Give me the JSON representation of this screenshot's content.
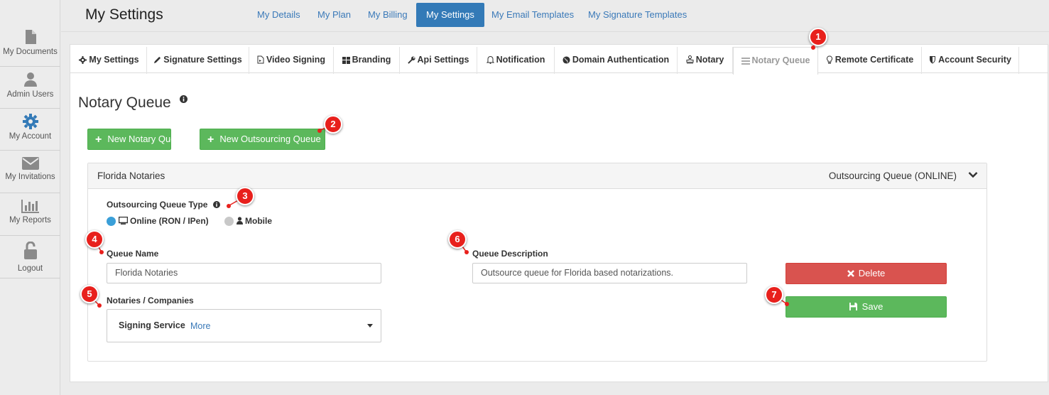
{
  "sidebar": {
    "items": [
      {
        "label": "My Documents",
        "icon": "document-icon"
      },
      {
        "label": "Admin Users",
        "icon": "user-icon"
      },
      {
        "label": "My Account",
        "icon": "gear-icon"
      },
      {
        "label": "My Invitations",
        "icon": "envelope-icon"
      },
      {
        "label": "My Reports",
        "icon": "bar-chart-icon"
      },
      {
        "label": "Logout",
        "icon": "unlock-icon"
      }
    ]
  },
  "header": {
    "title": "My Settings",
    "nav": [
      "My Details",
      "My Plan",
      "My Billing",
      "My Settings",
      "My Email Templates",
      "My Signature Templates"
    ],
    "active_nav": "My Settings"
  },
  "tabs": [
    {
      "label": "My Settings",
      "icon": "gear-icon"
    },
    {
      "label": "Signature Settings",
      "icon": "pencil-icon"
    },
    {
      "label": "Video Signing",
      "icon": "video-file-icon"
    },
    {
      "label": "Branding",
      "icon": "grid-icon"
    },
    {
      "label": "Api Settings",
      "icon": "wrench-icon"
    },
    {
      "label": "Notification",
      "icon": "bell-icon"
    },
    {
      "label": "Domain Authentication",
      "icon": "globe-icon"
    },
    {
      "label": "Notary",
      "icon": "stamp-icon"
    },
    {
      "label": "Notary Queue",
      "icon": "list-icon"
    },
    {
      "label": "Remote Certificate",
      "icon": "lightbulb-icon"
    },
    {
      "label": "Account Security",
      "icon": "shield-icon"
    }
  ],
  "active_tab": "Notary Queue",
  "page": {
    "title": "Notary Queue",
    "new_notary_queue_label": "New Notary Queue",
    "new_outsourcing_queue_label": "New Outsourcing Queue"
  },
  "queue": {
    "name": "Florida Notaries",
    "status": "Outsourcing Queue (ONLINE)",
    "type_label": "Outsourcing Queue Type",
    "type_options": [
      {
        "label": "Online (RON / IPen)",
        "selected": true,
        "icon": "monitor-icon"
      },
      {
        "label": "Mobile",
        "selected": false,
        "icon": "person-icon"
      }
    ],
    "queue_name_label": "Queue Name",
    "queue_name_value": "Florida Notaries",
    "queue_description_label": "Queue Description",
    "queue_description_value": "Outsource queue for Florida based notarizations.",
    "notaries_label": "Notaries / Companies",
    "notaries_selected": "Signing Service",
    "notaries_more": "More",
    "delete_label": "Delete",
    "save_label": "Save"
  },
  "callouts": [
    "1",
    "2",
    "3",
    "4",
    "5",
    "6",
    "7"
  ],
  "colors": {
    "primary": "#337ab7",
    "success": "#5cb85c",
    "danger": "#d9534f",
    "callout": "#e8201c",
    "radio_selected": "#3a9fd8",
    "radio_unselected": "#c8c8c8"
  }
}
